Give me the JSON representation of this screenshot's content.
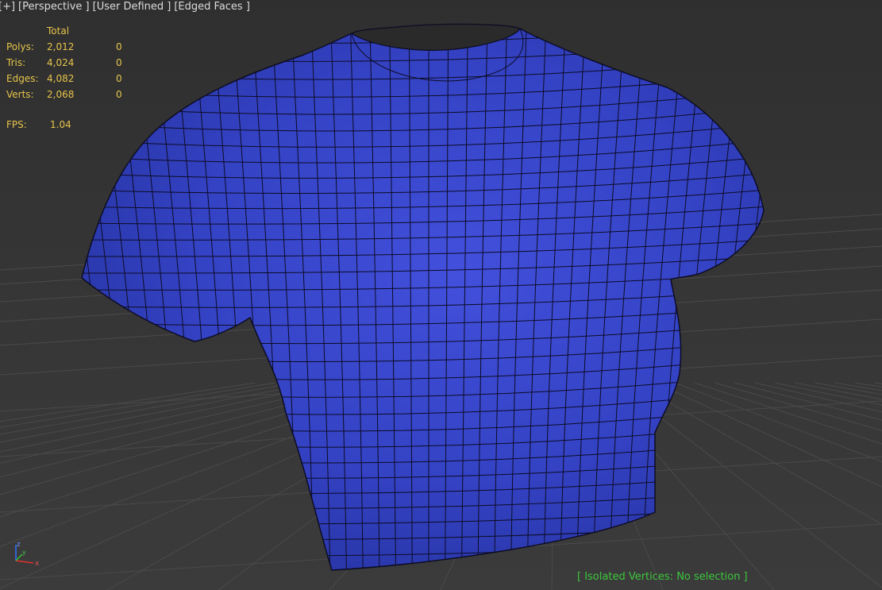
{
  "viewport_label": {
    "plus": "[+]",
    "view": "[Perspective ]",
    "shading_mode": "[User Defined ]",
    "display": "[Edged Faces ]"
  },
  "statistics": {
    "column_header": "Total",
    "rows": [
      {
        "label": "Polys:",
        "total": "2,012",
        "selected": "0"
      },
      {
        "label": "Tris:",
        "total": "4,024",
        "selected": "0"
      },
      {
        "label": "Edges:",
        "total": "4,082",
        "selected": "0"
      },
      {
        "label": "Verts:",
        "total": "2,068",
        "selected": "0"
      }
    ],
    "fps_label": "FPS:",
    "fps_value": "1.04"
  },
  "status": {
    "isolated_vertices": "[ Isolated Vertices: No selection ]"
  },
  "axis_gizmo": {
    "x": "x",
    "y": "y",
    "z": "z"
  },
  "colors": {
    "viewport_bg": "#3a3a3a",
    "mesh_fill": "#3a48c8",
    "mesh_wire": "#0c0c24",
    "stats_text": "#e6c44a",
    "status_text": "#3cc83c",
    "grid_line": "#4a4a4a"
  }
}
